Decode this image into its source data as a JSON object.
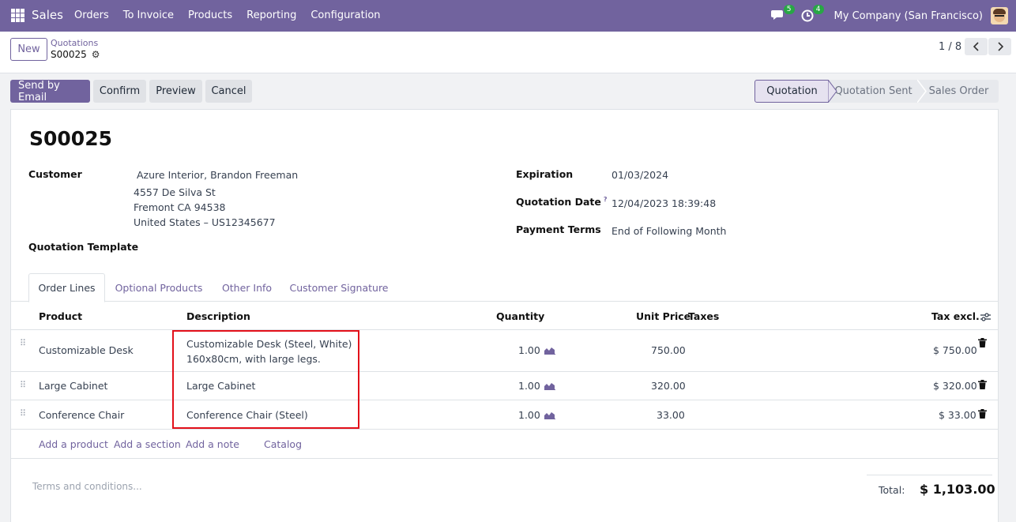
{
  "navbar": {
    "app_name": "Sales",
    "menu": [
      "Orders",
      "To Invoice",
      "Products",
      "Reporting",
      "Configuration"
    ],
    "messages_count": "5",
    "activities_count": "4",
    "company": "My Company (San Francisco)"
  },
  "control": {
    "new_label": "New",
    "breadcrumb_parent": "Quotations",
    "breadcrumb_current": "S00025",
    "pager": "1 / 8"
  },
  "actions": {
    "send_email": "Send by Email",
    "confirm": "Confirm",
    "preview": "Preview",
    "cancel": "Cancel"
  },
  "stages": [
    "Quotation",
    "Quotation Sent",
    "Sales Order"
  ],
  "form": {
    "title": "S00025",
    "customer_label": "Customer",
    "customer_name": "Azure Interior, Brandon Freeman",
    "address_line1": "4557 De Silva St",
    "address_line2": "Fremont CA 94538",
    "address_line3": "United States – US12345677",
    "template_label": "Quotation Template",
    "expiration_label": "Expiration",
    "expiration_value": "01/03/2024",
    "quote_date_label": "Quotation Date",
    "quote_date_help": "?",
    "quote_date_value": "12/04/2023 18:39:48",
    "payment_terms_label": "Payment Terms",
    "payment_terms_value": "End of Following Month"
  },
  "tabs": [
    "Order Lines",
    "Optional Products",
    "Other Info",
    "Customer Signature"
  ],
  "table": {
    "headers": {
      "product": "Product",
      "description": "Description",
      "quantity": "Quantity",
      "unit_price": "Unit Price",
      "taxes": "Taxes",
      "tax_excl": "Tax excl."
    },
    "rows": [
      {
        "product": "Customizable Desk",
        "desc1": "Customizable Desk (Steel, White)",
        "desc2": "160x80cm, with large legs.",
        "qty": "1.00",
        "price": "750.00",
        "subtotal": "$ 750.00"
      },
      {
        "product": "Large Cabinet",
        "desc1": "Large Cabinet",
        "qty": "1.00",
        "price": "320.00",
        "subtotal": "$ 320.00"
      },
      {
        "product": "Conference Chair",
        "desc1": "Conference Chair (Steel)",
        "qty": "1.00",
        "price": "33.00",
        "subtotal": "$ 33.00"
      }
    ],
    "add_links": {
      "product": "Add a product",
      "section": "Add a section",
      "note": "Add a note",
      "catalog": "Catalog"
    }
  },
  "footer": {
    "terms_placeholder": "Terms and conditions...",
    "total_label": "Total:",
    "total_value": "$ 1,103.00"
  },
  "colors": {
    "brand": "#71639e",
    "highlight": "#e3101a"
  }
}
